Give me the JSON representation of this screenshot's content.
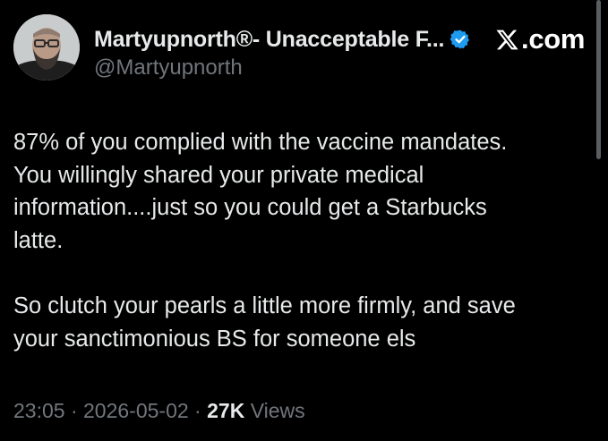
{
  "author": {
    "display_name": "Martyupnorth®- Unacceptable F...",
    "handle": "@Martyupnorth",
    "verified_color": "#1d9bf0"
  },
  "brand": {
    "label": ".com"
  },
  "icons": {
    "avatar": "avatar-photo",
    "verified": "verified-badge-icon",
    "brand": "x-logo-icon"
  },
  "tweet": {
    "lines_para1": [
      "87% of you complied with the vaccine mandates.",
      "You willingly shared your private medical",
      "information....just so you could get a Starbucks",
      "latte."
    ],
    "lines_para2": [
      "So clutch your pearls a little more firmly, and save",
      "your sanctimonious BS for someone els"
    ]
  },
  "meta": {
    "time": "23:05",
    "separator": " · ",
    "date": "2026-05-02",
    "views_count": "27K",
    "views_label": " Views"
  },
  "colors": {
    "background": "#000000",
    "text": "#e7e9ea",
    "secondary_text": "#71767b"
  }
}
